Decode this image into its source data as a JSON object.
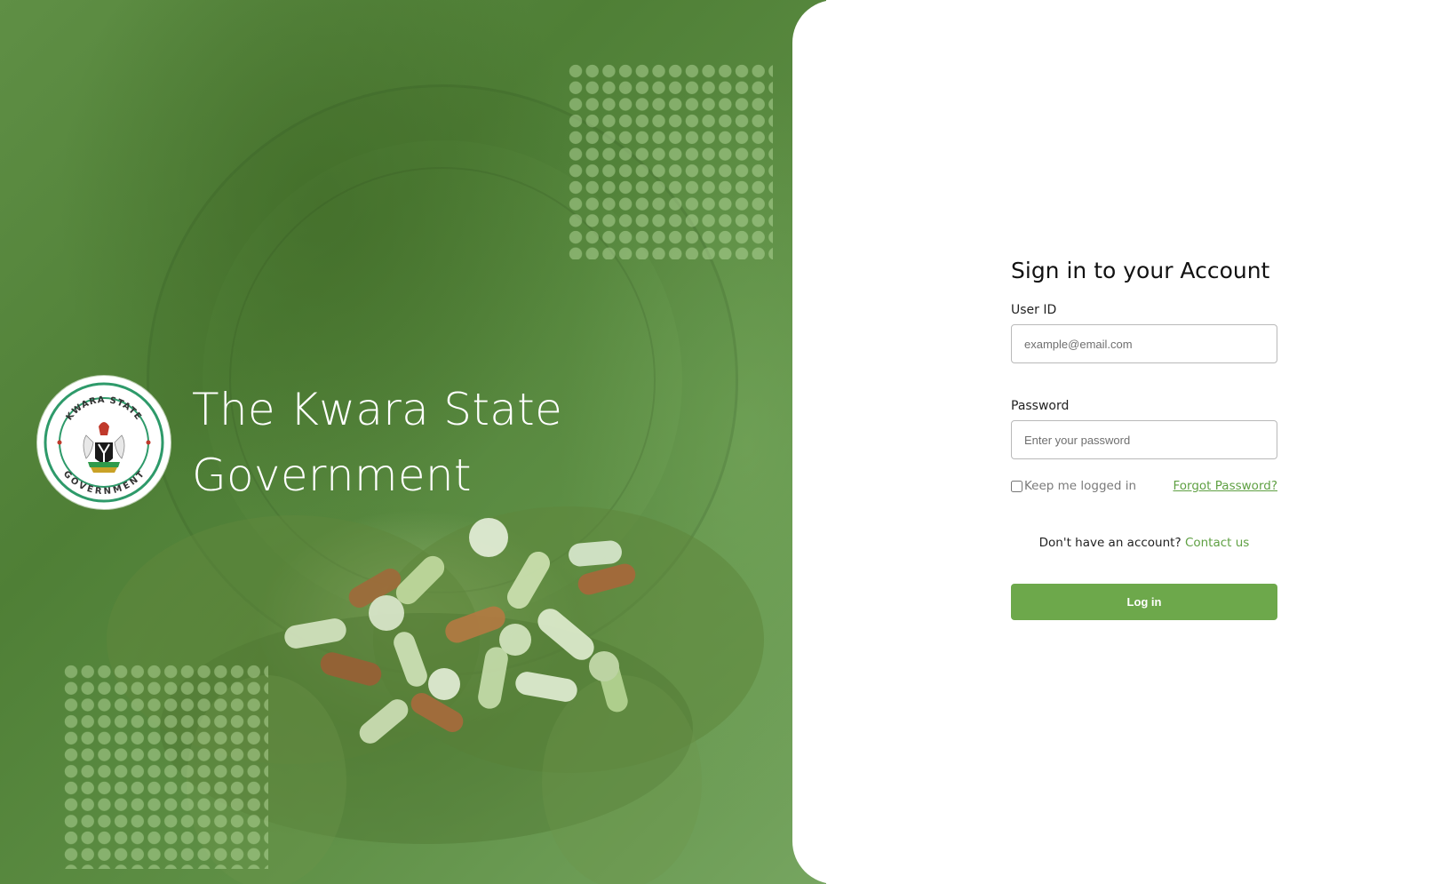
{
  "hero": {
    "title_line1": "The Kwara State",
    "title_line2": "Government",
    "logo": {
      "icon": "kwara-state-government-seal-icon",
      "ring_text_top": "KWARA STATE",
      "ring_text_bottom": "GOVERNMENT"
    },
    "background_color": "#5a8a40"
  },
  "login": {
    "heading": "Sign in to your Account",
    "user_id_label": "User ID",
    "user_id_placeholder": "example@email.com",
    "user_id_value": "",
    "password_label": "Password",
    "password_placeholder": "Enter your password",
    "password_value": "",
    "keep_logged_in_label": "Keep me logged in",
    "keep_logged_in_checked": false,
    "forgot_password_label": "Forgot Password?",
    "no_account_text": "Don't have an account?",
    "contact_link_label": "Contact us",
    "login_button_label": "Log in"
  },
  "colors": {
    "accent_green": "#6da84b",
    "link_green": "#5fa043",
    "panel_background": "#ffffff"
  }
}
